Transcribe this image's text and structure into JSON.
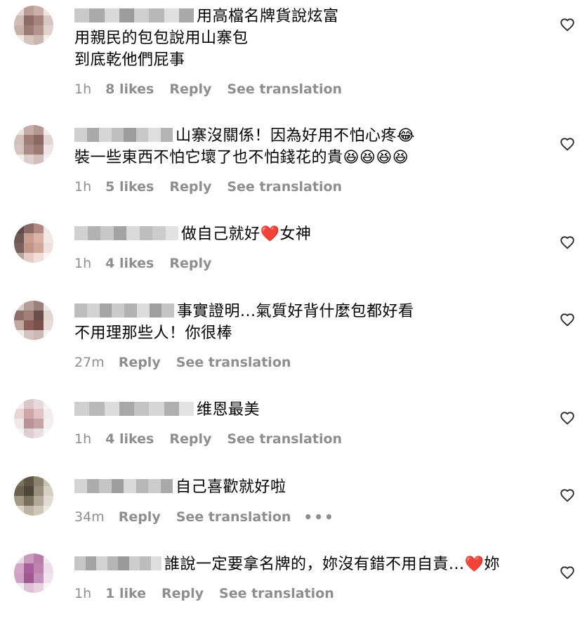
{
  "comments": [
    {
      "avatar_colors": [
        "#e4d6d3",
        "#b99d96",
        "#c9b0ab",
        "#efe4e2",
        "#d1bbb6",
        "#8e6c66",
        "#a5847e",
        "#d8c6c2",
        "#c7b0aa",
        "#9d7b74",
        "#b3948d",
        "#e1d1cd",
        "#f0e7e5",
        "#d6c4c0",
        "#cbb7b2",
        "#f4eeec"
      ],
      "username_colors": [
        "#c9c9c9",
        "#aaaaaa",
        "#d8d8d8",
        "#9c9c9c",
        "#cfcfcf",
        "#b8b8b8",
        "#e0e0e0",
        "#a8a8a8"
      ],
      "text": "用高檔名牌貨說炫富\n用親民的包包說用山寨包\n到底乾他們屁事",
      "time": "1h",
      "likes": "8 likes",
      "reply": "Reply",
      "translate": "See translation",
      "more": ""
    },
    {
      "avatar_colors": [
        "#ece3e1",
        "#c6aca8",
        "#b69892",
        "#f1ebea",
        "#d3c0bd",
        "#9f7e78",
        "#8c6862",
        "#e2d5d3",
        "#d6c4c0",
        "#ab8d88",
        "#9b7a74",
        "#eee6e4",
        "#f4eeed",
        "#dccfcc",
        "#d0bfbb",
        "#f7f2f1"
      ],
      "username_colors": [
        "#cfcfcf",
        "#a9a9a9",
        "#d6d6d6",
        "#bfbfbf",
        "#9d9d9d",
        "#c8c8c8",
        "#dedede",
        "#b4b4b4"
      ],
      "text": "山寨沒關係！因為好用不怕心疼😂\n裝一些東西不怕它壞了也不怕錢花的貴😆😆😆😆",
      "time": "1h",
      "likes": "5 likes",
      "reply": "Reply",
      "translate": "See translation",
      "more": ""
    },
    {
      "avatar_colors": [
        "#5b4c48",
        "#8a6a62",
        "#b08a80",
        "#efe4e0",
        "#6d5852",
        "#c89c8f",
        "#d9b3a6",
        "#f2e8e4",
        "#7a625c",
        "#be9587",
        "#cfa89b",
        "#ede1dc",
        "#b9a49e",
        "#e4cdc5",
        "#efdfd9",
        "#f8f2f0"
      ],
      "username_colors": [
        "#d1d1d1",
        "#b2b2b2",
        "#c7c7c7",
        "#a3a3a3",
        "#dadada",
        "#bdbdbd",
        "#cccccc",
        "#e2e2e2"
      ],
      "text": "做自己就好❤️女神",
      "time": "1h",
      "likes": "4 likes",
      "reply": "Reply",
      "translate": "",
      "more": ""
    },
    {
      "avatar_colors": [
        "#d8cfcc",
        "#b59e98",
        "#9a807a",
        "#ede7e5",
        "#8d6e69",
        "#a07f79",
        "#6a4e49",
        "#e0d6d3",
        "#c3a7a1",
        "#8a5e58",
        "#7a504a",
        "#e6dcd9",
        "#efe9e7",
        "#d4c4c0",
        "#cbb8b4",
        "#f5f1f0"
      ],
      "username_colors": [
        "#bdbdbd",
        "#d3d3d3",
        "#a6a6a6",
        "#cacaca",
        "#b1b1b1",
        "#dcdcdc",
        "#9f9f9f",
        "#c4c4c4"
      ],
      "text": "事實證明...氣質好背什麼包都好看\n不用理那些人！你很棒",
      "time": "27m",
      "likes": "",
      "reply": "Reply",
      "translate": "See translation",
      "more": ""
    },
    {
      "avatar_colors": [
        "#f2eeee",
        "#d9c8c8",
        "#e6dada",
        "#f6f3f3",
        "#e9d5d6",
        "#cfa6a8",
        "#e2c2c4",
        "#f3ecec",
        "#f0e8e8",
        "#b89295",
        "#c7a3a6",
        "#f4efef",
        "#f7f5f5",
        "#dcd0d0",
        "#e8e0e0",
        "#f9f7f7"
      ],
      "username_colors": [
        "#cfcfcf",
        "#b9b9b9",
        "#dcdcdc",
        "#a8a8a8",
        "#c3c3c3",
        "#d6d6d6",
        "#b0b0b0",
        "#e3e3e3"
      ],
      "text": "维恩最美",
      "time": "1h",
      "likes": "4 likes",
      "reply": "Reply",
      "translate": "See translation",
      "more": ""
    },
    {
      "avatar_colors": [
        "#7d7361",
        "#5e5545",
        "#8c8270",
        "#c8c0b2",
        "#6b6150",
        "#4e4638",
        "#9a8f7c",
        "#d5cfc4",
        "#a39884",
        "#7a6f5c",
        "#b3a893",
        "#e0dbd2",
        "#d9d3c8",
        "#bdb3a2",
        "#cfc7ba",
        "#ece8e2"
      ],
      "username_colors": [
        "#d4d4d4",
        "#acacac",
        "#c5c5c5",
        "#9e9e9e",
        "#dadada",
        "#b7b7b7",
        "#cccccc",
        "#a9a9a9"
      ],
      "text": "自己喜歡就好啦",
      "time": "34m",
      "likes": "",
      "reply": "Reply",
      "translate": "See translation",
      "more": "•••"
    },
    {
      "avatar_colors": [
        "#e9dbe6",
        "#c99bbd",
        "#b77fa8",
        "#f1e8ef",
        "#d3a6c7",
        "#a8609a",
        "#bd82ae",
        "#ecdde8",
        "#cfa2c3",
        "#9d5a8e",
        "#c392b8",
        "#f0e5ed",
        "#f3edf1",
        "#dcc3d5",
        "#e6d2e0",
        "#f8f4f7"
      ],
      "username_colors": [
        "#c6c6c6",
        "#a4a4a4",
        "#d3d3d3",
        "#b6b6b6",
        "#9a9a9a",
        "#cdcdcd",
        "#bcbcbc",
        "#dedede"
      ],
      "text": "誰說一定要拿名牌的，妳沒有錯不用自責...❤️妳",
      "time": "1h",
      "likes": "1 like",
      "reply": "Reply",
      "translate": "See translation",
      "more": ""
    }
  ]
}
